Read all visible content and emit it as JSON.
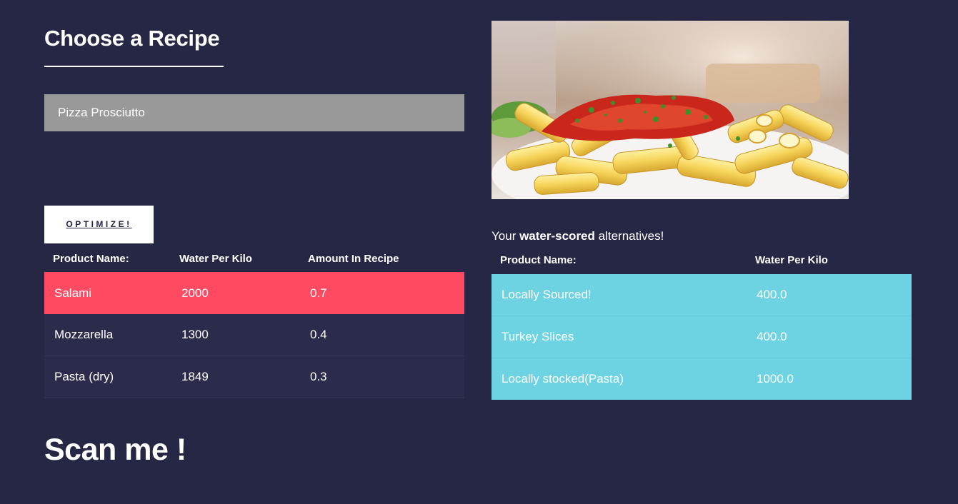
{
  "recipe_panel": {
    "title": "Choose a Recipe",
    "selected_recipe": "Pizza Prosciutto",
    "optimize_label": "OPTIMIZE!"
  },
  "ingredients_table": {
    "headers": [
      "Product Name:",
      "Water Per Kilo",
      "Amount In Recipe"
    ],
    "rows": [
      {
        "name": "Salami",
        "water_per_kilo": "2000",
        "amount": "0.7",
        "highlighted": true
      },
      {
        "name": "Mozzarella",
        "water_per_kilo": "1300",
        "amount": "0.4",
        "highlighted": false
      },
      {
        "name": "Pasta (dry)",
        "water_per_kilo": "1849",
        "amount": "0.3",
        "highlighted": false
      }
    ]
  },
  "alternatives": {
    "caption_prefix": "Your ",
    "caption_bold": "water-scored",
    "caption_suffix": " alternatives!",
    "headers": [
      "Product Name:",
      "Water Per Kilo"
    ],
    "rows": [
      {
        "name": "Locally Sourced!",
        "water_per_kilo": "400.0"
      },
      {
        "name": "Turkey Slices",
        "water_per_kilo": "400.0"
      },
      {
        "name": "Locally stocked(Pasta)",
        "water_per_kilo": "1000.0"
      }
    ]
  },
  "scan_heading": "Scan me !",
  "colors": {
    "background": "#262745",
    "highlight_row": "#ff4a62",
    "alternatives_table": "#6dd3e3",
    "select_box": "#999999"
  },
  "images": {
    "food_photo": "pasta-dish-photo"
  }
}
